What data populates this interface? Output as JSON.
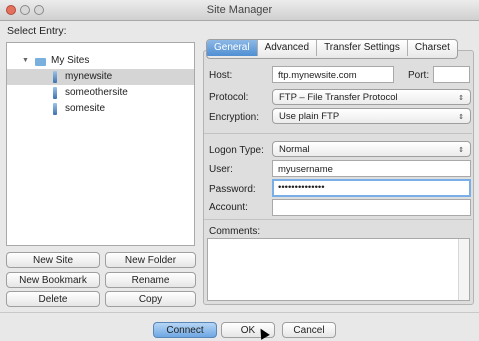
{
  "window": {
    "title": "Site Manager"
  },
  "select_entry_label": "Select Entry:",
  "tree": {
    "root": "My Sites",
    "items": [
      "mynewsite",
      "someothersite",
      "somesite"
    ],
    "selected": "mynewsite"
  },
  "left_buttons": {
    "new_site": "New Site",
    "new_folder": "New Folder",
    "new_bookmark": "New Bookmark",
    "rename": "Rename",
    "delete": "Delete",
    "copy": "Copy"
  },
  "tabs": [
    "General",
    "Advanced",
    "Transfer Settings",
    "Charset"
  ],
  "active_tab": "General",
  "form": {
    "host_label": "Host:",
    "host_value": "ftp.mynewsite.com",
    "port_label": "Port:",
    "port_value": "",
    "protocol_label": "Protocol:",
    "protocol_value": "FTP – File Transfer Protocol",
    "encryption_label": "Encryption:",
    "encryption_value": "Use plain FTP",
    "logon_type_label": "Logon Type:",
    "logon_type_value": "Normal",
    "user_label": "User:",
    "user_value": "myusername",
    "password_label": "Password:",
    "password_value": "••••••••••••••",
    "account_label": "Account:",
    "account_value": "",
    "comments_label": "Comments:",
    "comments_value": ""
  },
  "bottom_buttons": {
    "connect": "Connect",
    "ok": "OK",
    "cancel": "Cancel"
  },
  "colors": {
    "accent": "#5b9ae0",
    "selection": "#d5d5d5",
    "close": "#e4705e"
  }
}
